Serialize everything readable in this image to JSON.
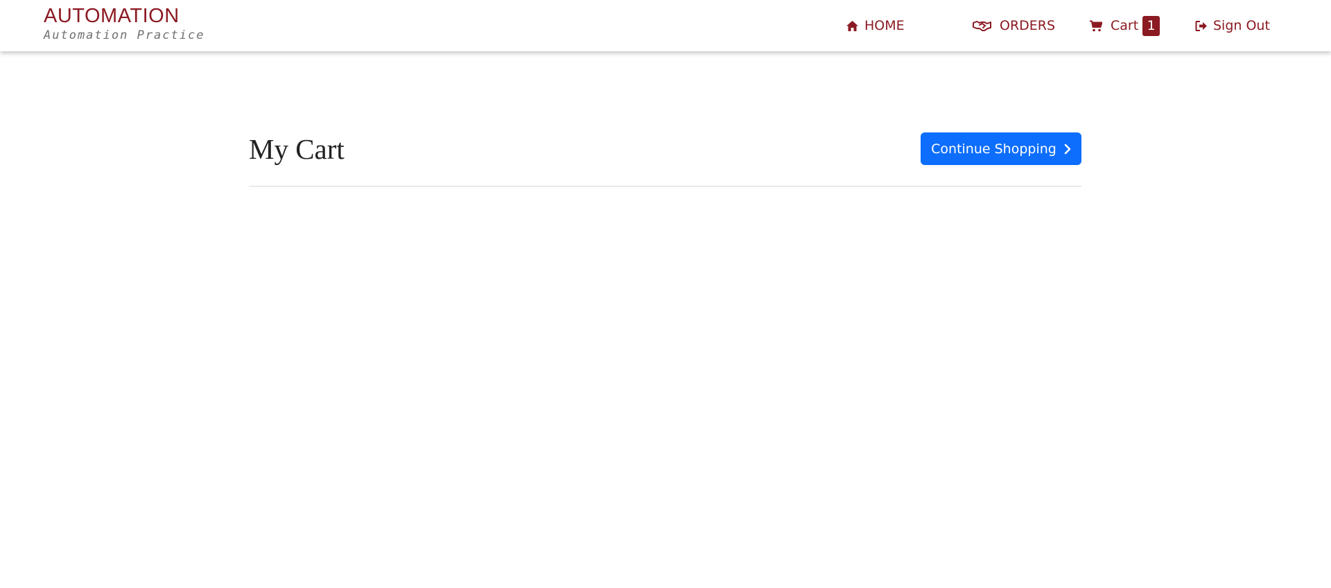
{
  "brand": {
    "title": "AUTOMATION",
    "subtitle": "Automation Practice"
  },
  "nav": {
    "home": {
      "label": "HOME",
      "icon": "home-icon"
    },
    "orders": {
      "label": "ORDERS",
      "icon": "handshake-icon"
    },
    "cart": {
      "label": "Cart",
      "icon": "cart-icon",
      "count": "1"
    },
    "signout": {
      "label": "Sign Out",
      "icon": "sign-out-icon"
    }
  },
  "main": {
    "title": "My Cart",
    "continue_label": "Continue Shopping",
    "continue_icon": "chevron-right-icon"
  },
  "colors": {
    "brand_red": "#8b1a22",
    "primary_blue": "#0d6efd",
    "subtitle_gray": "#6f6f6f",
    "divider": "#d8d8d8"
  }
}
